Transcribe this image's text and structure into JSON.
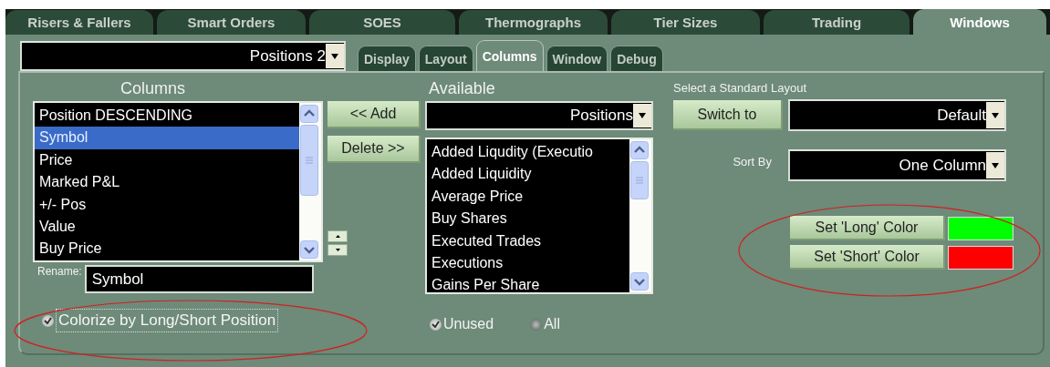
{
  "tabs": [
    {
      "label": "Risers & Fallers",
      "selected": false
    },
    {
      "label": "Smart Orders",
      "selected": false
    },
    {
      "label": "SOES",
      "selected": false
    },
    {
      "label": "Thermographs",
      "selected": false
    },
    {
      "label": "Tier Sizes",
      "selected": false
    },
    {
      "label": "Trading",
      "selected": false
    },
    {
      "label": "Windows",
      "selected": true
    }
  ],
  "window_selector": {
    "value": "Positions 2"
  },
  "subtabs": [
    {
      "label": "Display",
      "selected": false
    },
    {
      "label": "Layout",
      "selected": false
    },
    {
      "label": "Columns",
      "selected": true
    },
    {
      "label": "Window",
      "selected": false
    },
    {
      "label": "Debug",
      "selected": false
    }
  ],
  "columns": {
    "heading": "Columns",
    "items": [
      {
        "label": "Position DESCENDING",
        "selected": false
      },
      {
        "label": "Symbol",
        "selected": true
      },
      {
        "label": "Price",
        "selected": false
      },
      {
        "label": "Marked P&L",
        "selected": false
      },
      {
        "label": "+/- Pos",
        "selected": false
      },
      {
        "label": "Value",
        "selected": false
      },
      {
        "label": "Buy Price",
        "selected": false
      }
    ],
    "buttons": [
      "<< Add",
      "Delete >>"
    ],
    "rename": {
      "label": "Rename:",
      "value": "Symbol"
    },
    "colorize": {
      "label": "Colorize by Long/Short Position",
      "checked": true
    }
  },
  "available": {
    "heading": "Available",
    "source": "Positions",
    "items": [
      {
        "label": "Added Liqudity (Executio",
        "selected": false
      },
      {
        "label": "Added Liquidity",
        "selected": false
      },
      {
        "label": "Average Price",
        "selected": false
      },
      {
        "label": "Buy Shares",
        "selected": false
      },
      {
        "label": "Executed Trades",
        "selected": false
      },
      {
        "label": "Executions",
        "selected": false
      },
      {
        "label": "Gains Per Share",
        "selected": false
      }
    ],
    "filters": [
      {
        "label": "Unused",
        "selected": true
      },
      {
        "label": "All",
        "selected": false
      }
    ]
  },
  "standard_layout": {
    "label": "Select a Standard Layout",
    "button": "Switch to",
    "layout": "Default",
    "sort_label": "Sort By",
    "sort_value": "One Column"
  },
  "colors": [
    {
      "label": "Set 'Long' Color",
      "color": "#00ff00"
    },
    {
      "label": "Set 'Short' Color",
      "color": "#ff0000"
    }
  ]
}
